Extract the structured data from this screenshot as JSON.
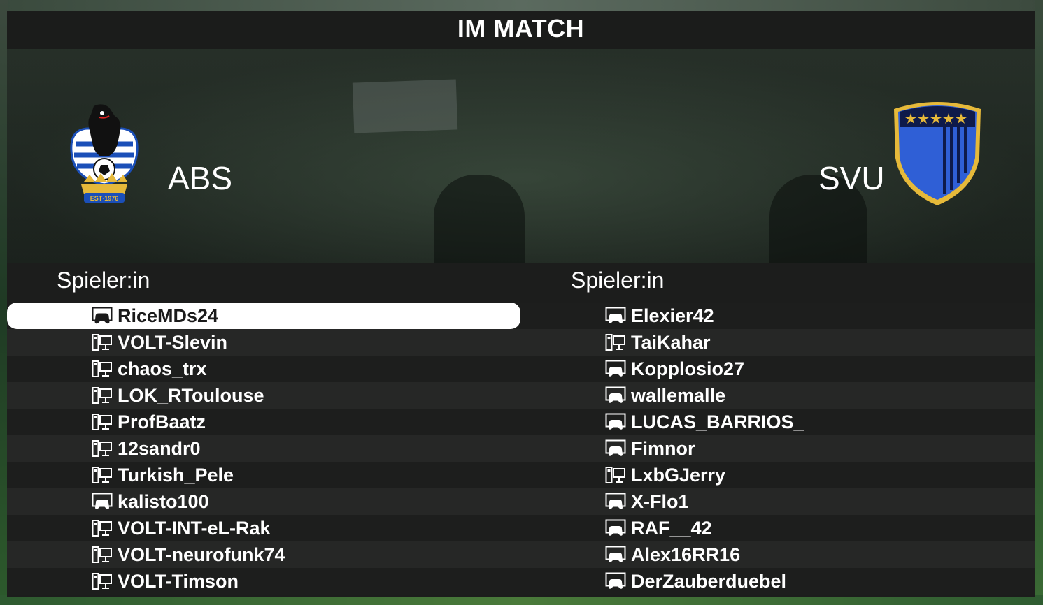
{
  "title": "IM MATCH",
  "home": {
    "name": "ABS",
    "logo_icon": "bear-crest-logo",
    "logo_text": "EST·1976",
    "roster_header": "Spieler:in",
    "players": [
      {
        "name": "RiceMDs24",
        "platform": "console",
        "selected": true
      },
      {
        "name": "VOLT-Slevin",
        "platform": "pc"
      },
      {
        "name": "chaos_trx",
        "platform": "pc"
      },
      {
        "name": "LOK_RToulouse",
        "platform": "pc"
      },
      {
        "name": "ProfBaatz",
        "platform": "pc"
      },
      {
        "name": "12sandr0",
        "platform": "pc"
      },
      {
        "name": "Turkish_Pele",
        "platform": "pc"
      },
      {
        "name": "kalisto100",
        "platform": "console"
      },
      {
        "name": "VOLT-INT-eL-Rak",
        "platform": "pc"
      },
      {
        "name": "VOLT-neurofunk74",
        "platform": "pc"
      },
      {
        "name": "VOLT-Timson",
        "platform": "pc"
      }
    ]
  },
  "away": {
    "name": "SVU",
    "logo_icon": "blue-shield-logo",
    "logo_stars": 5,
    "roster_header": "Spieler:in",
    "players": [
      {
        "name": "Elexier42",
        "platform": "console"
      },
      {
        "name": "TaiKahar",
        "platform": "pc"
      },
      {
        "name": "Kopplosio27",
        "platform": "console"
      },
      {
        "name": "wallemalle",
        "platform": "console"
      },
      {
        "name": "LUCAS_BARRIOS_",
        "platform": "console"
      },
      {
        "name": "Fimnor",
        "platform": "console"
      },
      {
        "name": "LxbGJerry",
        "platform": "pc"
      },
      {
        "name": "X-Flo1",
        "platform": "console"
      },
      {
        "name": "RAF__42",
        "platform": "console"
      },
      {
        "name": "Alex16RR16",
        "platform": "console"
      },
      {
        "name": "DerZauberduebel",
        "platform": "console"
      }
    ]
  },
  "colors": {
    "panel_dark": "#1b1c1b",
    "row_odd": "#1d1e1d",
    "row_even": "#262726",
    "selected_row": "#ffffff",
    "text": "#ffffff",
    "svu_blue": "#2f5fd6",
    "svu_gold": "#e6b93a",
    "abs_blue": "#1b4fb8"
  }
}
